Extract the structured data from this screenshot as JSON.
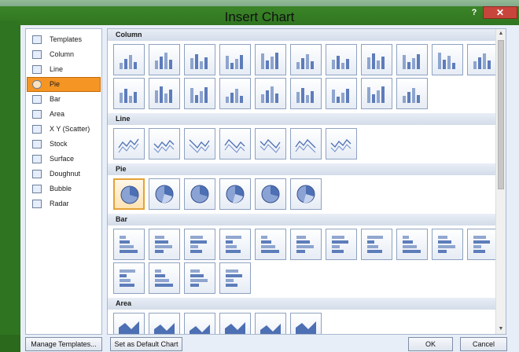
{
  "dialog": {
    "title": "Insert Chart",
    "help_label": "?",
    "close_label": "✕"
  },
  "sidebar": {
    "items": [
      {
        "label": "Templates",
        "icon": "folder-icon"
      },
      {
        "label": "Column",
        "icon": "column-chart-icon"
      },
      {
        "label": "Line",
        "icon": "line-chart-icon"
      },
      {
        "label": "Pie",
        "icon": "pie-chart-icon",
        "selected": true
      },
      {
        "label": "Bar",
        "icon": "bar-chart-icon"
      },
      {
        "label": "Area",
        "icon": "area-chart-icon"
      },
      {
        "label": "X Y (Scatter)",
        "icon": "scatter-chart-icon"
      },
      {
        "label": "Stock",
        "icon": "stock-chart-icon"
      },
      {
        "label": "Surface",
        "icon": "surface-chart-icon"
      },
      {
        "label": "Doughnut",
        "icon": "doughnut-chart-icon"
      },
      {
        "label": "Bubble",
        "icon": "bubble-chart-icon"
      },
      {
        "label": "Radar",
        "icon": "radar-chart-icon"
      }
    ]
  },
  "sections": [
    {
      "title": "Column",
      "kind": "column",
      "count": 20
    },
    {
      "title": "Line",
      "kind": "line",
      "count": 7
    },
    {
      "title": "Pie",
      "kind": "pie",
      "count": 6,
      "selected_index": 0
    },
    {
      "title": "Bar",
      "kind": "bar",
      "count": 15
    },
    {
      "title": "Area",
      "kind": "area",
      "count": 6
    }
  ],
  "footer": {
    "manage_templates": "Manage Templates...",
    "set_default": "Set as Default Chart",
    "ok": "OK",
    "cancel": "Cancel"
  },
  "colors": {
    "accent_selected": "#f59524",
    "tile_blue": "#4d6fb3"
  }
}
